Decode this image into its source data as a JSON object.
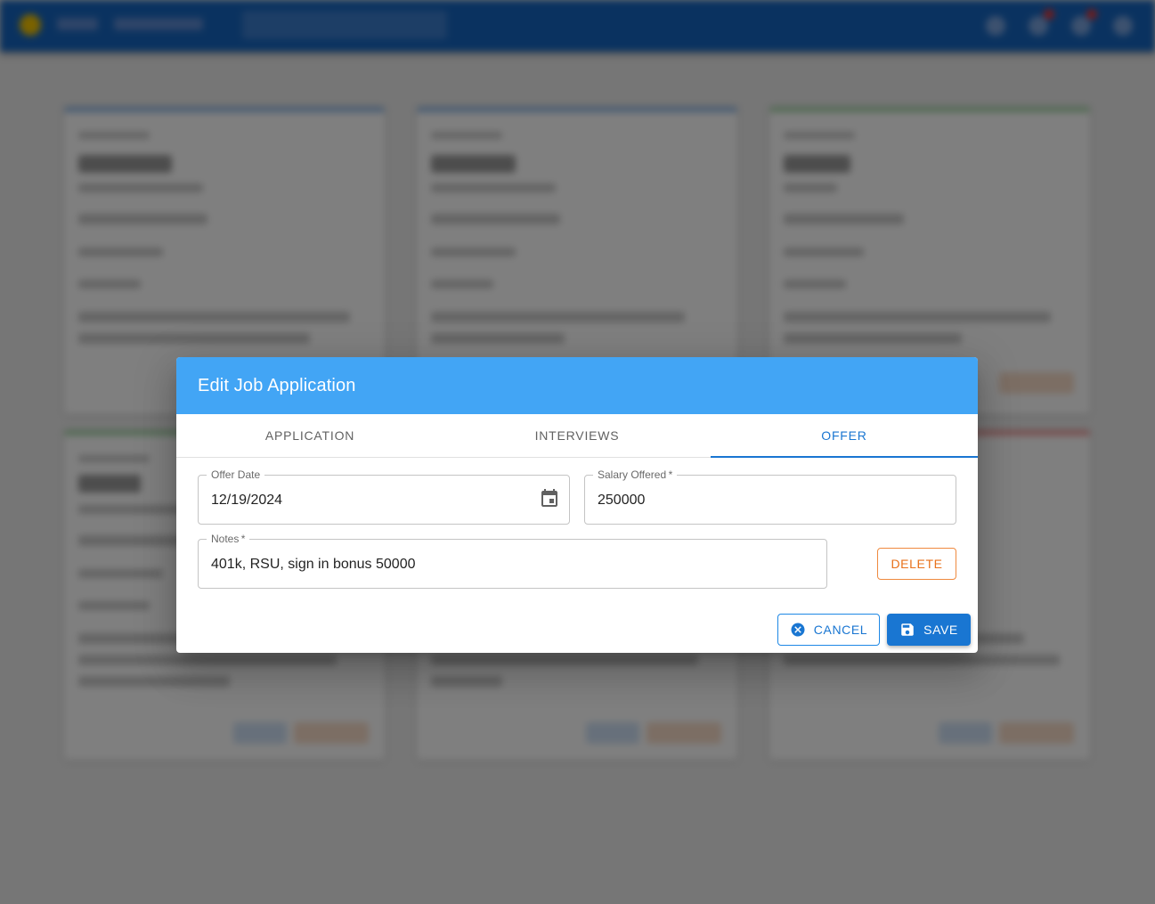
{
  "dialog": {
    "title": "Edit Job Application",
    "tabs": [
      {
        "label": "APPLICATION",
        "active": false
      },
      {
        "label": "INTERVIEWS",
        "active": false
      },
      {
        "label": "OFFER",
        "active": true
      }
    ],
    "offer_date": {
      "label": "Offer Date",
      "value": "12/19/2024",
      "icon": "calendar-icon"
    },
    "salary_offered": {
      "label": "Salary Offered",
      "required_mark": "*",
      "value": "250000"
    },
    "notes": {
      "label": "Notes",
      "required_mark": "*",
      "value": "401k, RSU, sign in bonus 50000"
    },
    "buttons": {
      "delete": "DELETE",
      "cancel": "CANCEL",
      "save": "SAVE"
    }
  },
  "colors": {
    "header": "#42a5f5",
    "primary": "#1976d2",
    "danger_outline": "#ef8a3f",
    "appbar": "#1565c0"
  }
}
